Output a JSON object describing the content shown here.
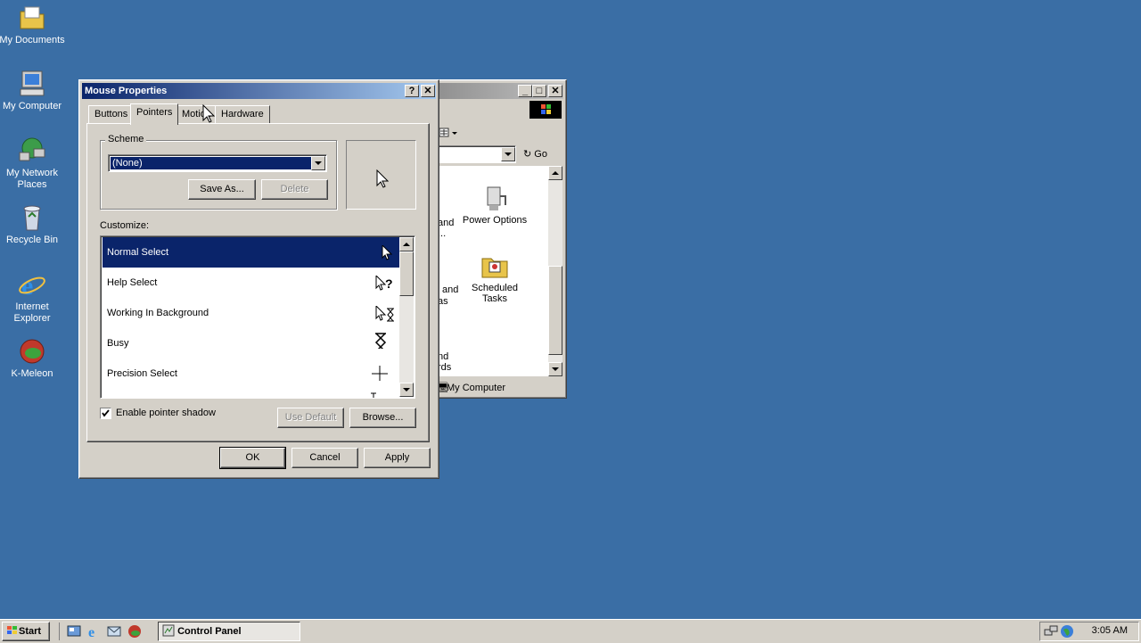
{
  "desktop": {
    "icons": [
      {
        "label": "My Documents",
        "icon": "folder-documents-icon"
      },
      {
        "label": "My Computer",
        "icon": "computer-icon"
      },
      {
        "label": "My Network Places",
        "icon": "network-places-icon"
      },
      {
        "label": "Recycle Bin",
        "icon": "recycle-bin-icon"
      },
      {
        "label": "Internet Explorer",
        "icon": "internet-explorer-icon"
      },
      {
        "label": "K-Meleon",
        "icon": "k-meleon-icon"
      }
    ]
  },
  "control_panel": {
    "address_go": "Go",
    "items": [
      {
        "label": "Power Options",
        "icon": "power-options-icon"
      },
      {
        "label": "Scheduled Tasks",
        "icon": "scheduled-tasks-icon"
      }
    ],
    "partial_items": [
      "and",
      "...",
      "and",
      "as",
      "nd",
      "rds"
    ],
    "status_text": "My Computer"
  },
  "dialog": {
    "title": "Mouse Properties",
    "tabs": [
      "Buttons",
      "Pointers",
      "Motion",
      "Hardware"
    ],
    "active_tab": "Pointers",
    "scheme_label": "Scheme",
    "scheme_value": "(None)",
    "save_as": "Save As...",
    "delete": "Delete",
    "customize_label": "Customize:",
    "pointers": [
      {
        "name": "Normal Select",
        "icon": "arrow-cursor-icon",
        "selected": true
      },
      {
        "name": "Help Select",
        "icon": "help-cursor-icon",
        "selected": false
      },
      {
        "name": "Working In Background",
        "icon": "working-cursor-icon",
        "selected": false
      },
      {
        "name": "Busy",
        "icon": "hourglass-cursor-icon",
        "selected": false
      },
      {
        "name": "Precision Select",
        "icon": "crosshair-cursor-icon",
        "selected": false
      }
    ],
    "shadow_label": "Enable pointer shadow",
    "shadow_checked": true,
    "use_default": "Use Default",
    "browse": "Browse...",
    "ok": "OK",
    "cancel": "Cancel",
    "apply": "Apply"
  },
  "taskbar": {
    "start": "Start",
    "task": "Control Panel",
    "clock": "3:05 AM"
  },
  "colors": {
    "desktop": "#3a6ea5",
    "titlebar_active": "#0a246a",
    "titlebar_inactive": "#808080",
    "selection": "#0a246a"
  }
}
